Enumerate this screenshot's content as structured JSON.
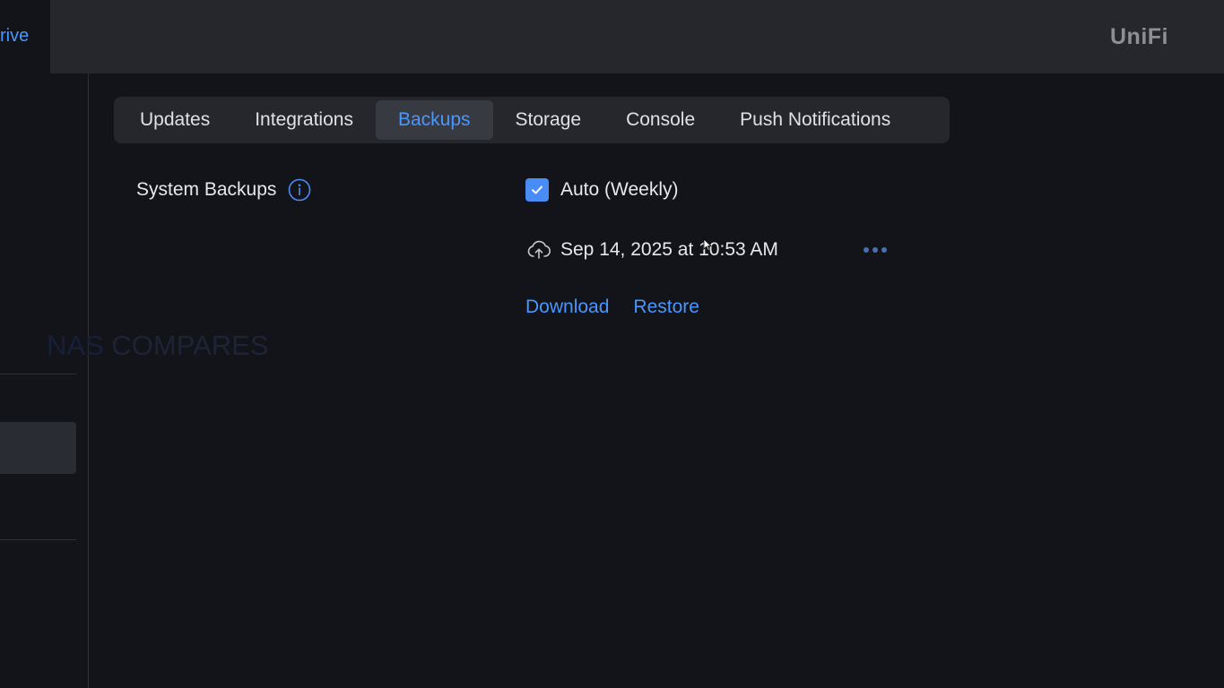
{
  "sidebar": {
    "partial_link": "rive"
  },
  "header": {
    "logo": "UniFi"
  },
  "watermark": {
    "text_a": "NAS",
    "text_b": "COMPARES"
  },
  "tabs": [
    {
      "label": "Updates",
      "active": false
    },
    {
      "label": "Integrations",
      "active": false
    },
    {
      "label": "Backups",
      "active": true
    },
    {
      "label": "Storage",
      "active": false
    },
    {
      "label": "Console",
      "active": false
    },
    {
      "label": "Push Notifications",
      "active": false
    }
  ],
  "backups": {
    "section_label": "System Backups",
    "auto_checkbox": {
      "label": "Auto (Weekly)",
      "checked": true
    },
    "last_backup": "Sep 14, 2025 at 10:53 AM",
    "download_label": "Download",
    "restore_label": "Restore"
  },
  "icons": {
    "info": "info-icon",
    "checkmark": "check-icon",
    "cloud": "cloud-upload-icon",
    "more": "more-dots-icon"
  },
  "colors": {
    "accent": "#4797ff",
    "background": "#131419",
    "header": "#26272d",
    "checkbox": "#4a8cf5"
  }
}
